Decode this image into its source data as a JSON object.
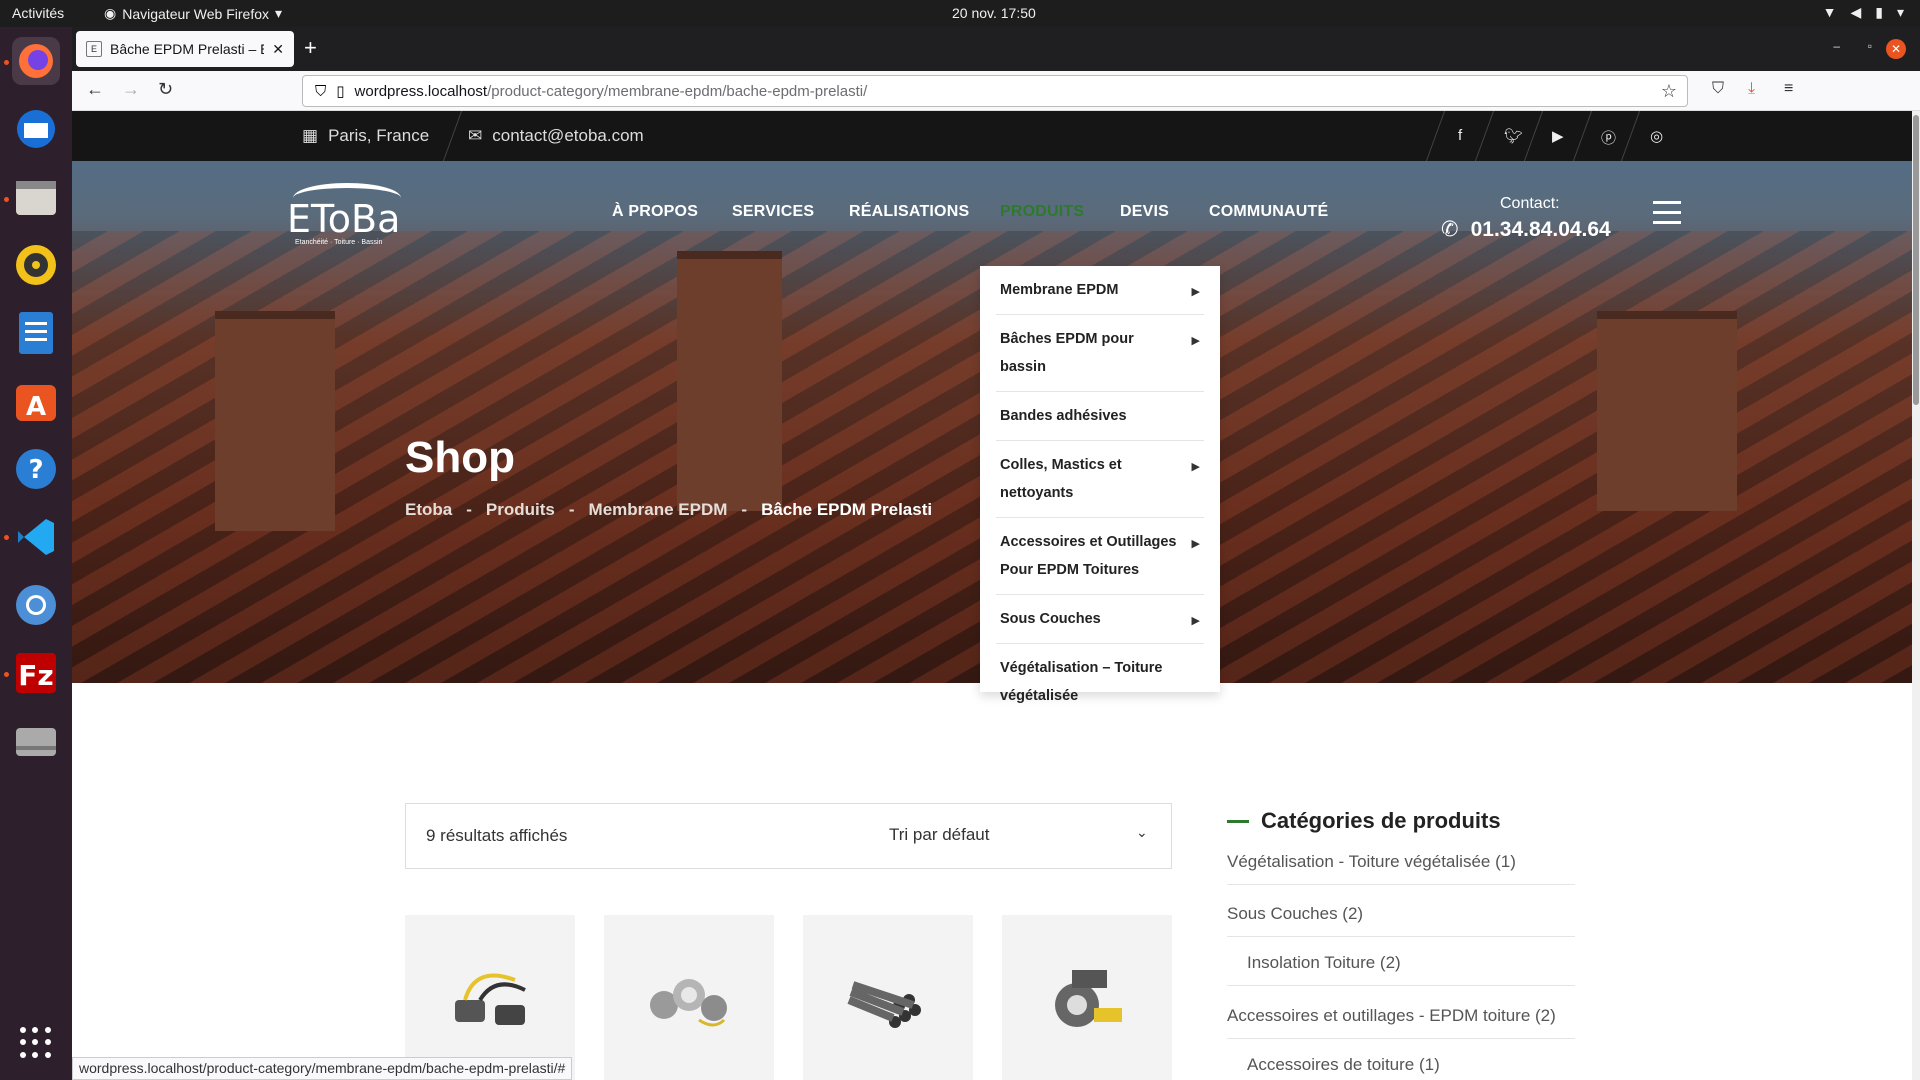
{
  "system": {
    "activities": "Activités",
    "app_name": "Navigateur Web Firefox",
    "clock": "20 nov.  17:50"
  },
  "browser": {
    "tab_title": "Bâche EPDM Prelasti – Et",
    "url_host": "wordpress.localhost",
    "url_path": "/product-category/membrane-epdm/bache-epdm-prelasti/",
    "status_url": "wordpress.localhost/product-category/membrane-epdm/bache-epdm-prelasti/#"
  },
  "site": {
    "top": {
      "location": "Paris, France",
      "email": "contact@etoba.com"
    },
    "logo": {
      "name": "EToBa",
      "tagline": "Etanchéité · Toiture · Bassin"
    },
    "menu": [
      "À PROPOS",
      "SERVICES",
      "RÉALISATIONS",
      "PRODUITS",
      "DEVIS",
      "COMMUNAUTÉ"
    ],
    "contact_label": "Contact:",
    "contact_phone": "01.34.84.04.64",
    "page_title": "Shop",
    "breadcrumb": [
      "Etoba",
      "Produits",
      "Membrane EPDM",
      "Bâche EPDM Prelasti"
    ],
    "breadcrumb_sep": "-",
    "dropdown": [
      {
        "label": "Membrane EPDM",
        "submenu": true
      },
      {
        "label": "Bâches EPDM pour bassin",
        "submenu": true
      },
      {
        "label": "Bandes adhésives",
        "submenu": false
      },
      {
        "label": "Colles, Mastics et nettoyants",
        "submenu": true
      },
      {
        "label": "Accessoires et Outillages Pour EPDM Toitures",
        "submenu": true
      },
      {
        "label": "Sous Couches",
        "submenu": true
      },
      {
        "label": "Végétalisation – Toiture végétalisée",
        "submenu": false
      }
    ],
    "results_count": "9 résultats affichés",
    "sort_default": "Tri par défaut",
    "sidebar": {
      "heading": "Catégories de produits",
      "items": [
        {
          "label": "Végétalisation - Toiture végétalisée (1)",
          "child": false
        },
        {
          "label": "Sous Couches (2)",
          "child": false
        },
        {
          "label": "Insolation Toiture (2)",
          "child": true
        },
        {
          "label": "Accessoires et outillages - EPDM toiture (2)",
          "child": false
        },
        {
          "label": "Accessoires de toiture (1)",
          "child": true
        }
      ]
    }
  },
  "colors": {
    "accent": "#2d7a2d",
    "close": "#e95420"
  }
}
